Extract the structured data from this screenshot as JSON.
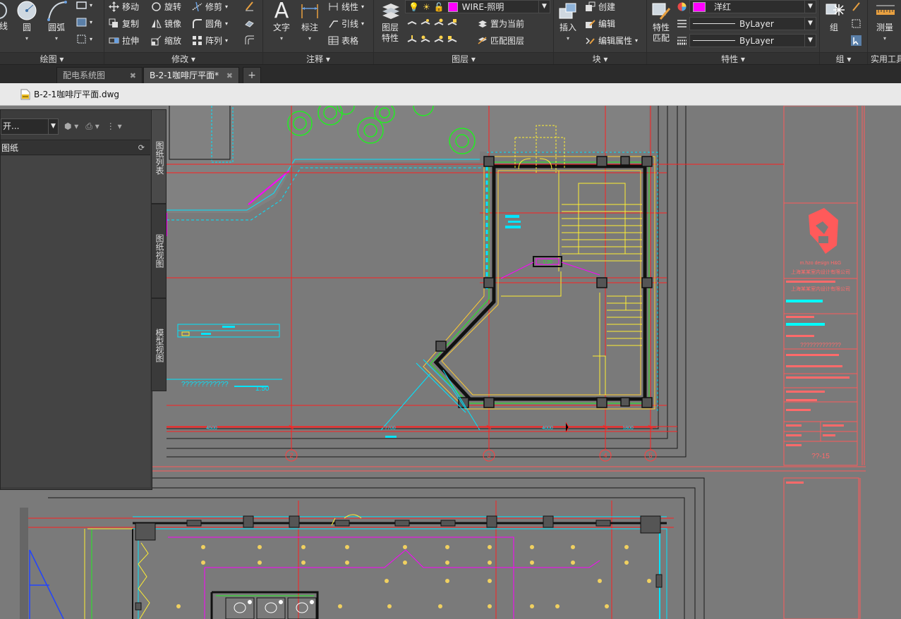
{
  "ribbon": {
    "draw": {
      "title": "绘图 ▾",
      "line_partial": "线",
      "circle": "圆",
      "arc": "圆弧"
    },
    "modify": {
      "title": "修改 ▾",
      "move": "移动",
      "rotate": "旋转",
      "trim": "修剪",
      "copy": "复制",
      "mirror": "镜像",
      "fillet": "圆角",
      "stretch": "拉伸",
      "scale": "缩放",
      "array": "阵列"
    },
    "annotation": {
      "title": "注释 ▾",
      "text": "文字",
      "dimension": "标注",
      "linear": "线性",
      "leader": "引线",
      "table": "表格"
    },
    "layers": {
      "title": "图层 ▾",
      "properties_line1": "图层",
      "properties_line2": "特性",
      "current_layer": "WIRE-照明",
      "current_layer_color": "#ff00ff",
      "set_current": "置为当前",
      "match_layer": "匹配图层"
    },
    "block": {
      "title": "块 ▾",
      "insert": "插入",
      "create": "创建",
      "edit": "编辑",
      "edit_attributes": "编辑属性"
    },
    "properties": {
      "title": "特性 ▾",
      "match_line1": "特性",
      "match_line2": "匹配",
      "color": "洋红",
      "color_hex": "#ff00ff",
      "linetype": "ByLayer",
      "lineweight": "ByLayer"
    },
    "groups": {
      "title": "组 ▾",
      "group": "组"
    },
    "utilities": {
      "title": "实用工具",
      "measure": "测量"
    }
  },
  "tabs": [
    {
      "label": "配电系统图"
    },
    {
      "label": "B-2-1咖啡厅平面*"
    }
  ],
  "document": {
    "filename": "B-2-1咖啡厅平面.dwg"
  },
  "sheet_palette": {
    "dropdown_value": "开...",
    "header": "图纸",
    "side_tabs": [
      "图纸列表",
      "图纸视图",
      "模型视图"
    ]
  },
  "drawing": {
    "grid_bubbles": [
      "2",
      "3",
      "4",
      "5"
    ],
    "dimensions": [
      "4500",
      "7700",
      "4000",
      "1800"
    ],
    "drawing_number": "??-15",
    "scale_label": "1:50",
    "title_text": "????????????",
    "title_block_text": "?????????????",
    "logo_text": "m.hzo design H&G",
    "company_name": "上海某某室内设计有限公司",
    "stair_label": "1.20"
  }
}
